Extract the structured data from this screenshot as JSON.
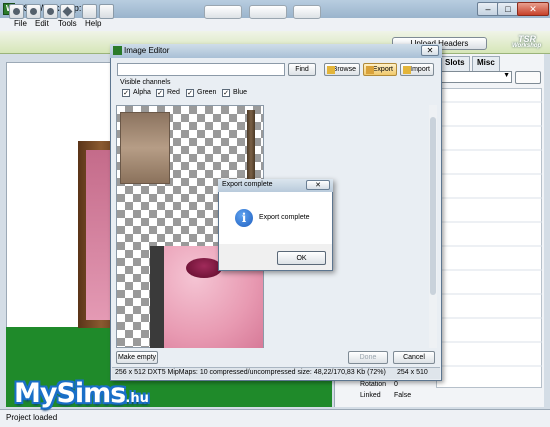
{
  "window": {
    "title": "TSR Workshop: *"
  },
  "menu": [
    "File",
    "Edit",
    "Tools",
    "Help"
  ],
  "toolbar": {
    "upload_label": "Upload Headers"
  },
  "logo": {
    "line1": "TSR",
    "line2": "Workshop"
  },
  "right_panel": {
    "tabs": [
      "Slots",
      "Misc"
    ],
    "properties": [
      {
        "key": "Rotation",
        "value": "0"
      },
      {
        "key": "Linked",
        "value": "False"
      }
    ]
  },
  "statusbar": {
    "text": "Project loaded"
  },
  "watermark": {
    "brand": "MySims",
    "suffix": ".hu"
  },
  "image_editor": {
    "title": "Image Editor",
    "search_value": "",
    "find_label": "Find",
    "browse_label": "Browse",
    "export_label": "Export",
    "import_label": "Import",
    "channels_label": "Visible channels",
    "channels": [
      {
        "label": "Alpha",
        "checked": true
      },
      {
        "label": "Red",
        "checked": true
      },
      {
        "label": "Green",
        "checked": true
      },
      {
        "label": "Blue",
        "checked": true
      }
    ],
    "make_empty_label": "Make empty",
    "done_label": "Done",
    "cancel_label": "Cancel",
    "status_left": "256 x 512 DXT5 MipMaps: 10 compressed/uncompressed size: 48,22/170,83 Kb (72%)",
    "status_right": "254 x 510"
  },
  "message_box": {
    "title": "Export complete",
    "message": "Export complete",
    "ok_label": "OK"
  }
}
